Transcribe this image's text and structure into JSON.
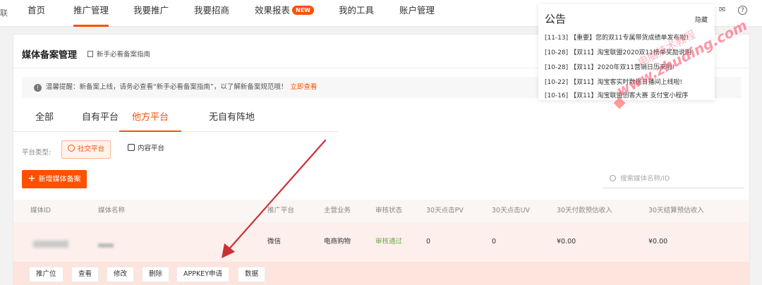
{
  "nav": {
    "logo_stub": "联",
    "items": [
      {
        "label": "首页"
      },
      {
        "label": "推广管理"
      },
      {
        "label": "我要推广"
      },
      {
        "label": "我要招商"
      },
      {
        "label": "效果报表"
      },
      {
        "label": "我的工具"
      },
      {
        "label": "账户管理"
      }
    ],
    "new_badge": "NEW",
    "mail_icon": "mail-icon",
    "help_icon": "help-icon"
  },
  "page": {
    "title": "媒体备案管理",
    "guide_link": "新手必看备案指南"
  },
  "tips": {
    "text": "温馨提醒：新备案上线，请务必查看“新手必看备案指南”，以了解新备案规范哦！",
    "link": "立即查看"
  },
  "tabs": [
    {
      "label": "全部"
    },
    {
      "label": "自有平台"
    },
    {
      "label": "他方平台"
    },
    {
      "label": "无自有阵地"
    }
  ],
  "platform_type": {
    "label": "平台类型:",
    "options": [
      {
        "label": "社交平台"
      },
      {
        "label": "内容平台"
      }
    ]
  },
  "add_button": "新增媒体备案",
  "search_placeholder": "搜索媒体名称/ID",
  "table": {
    "headers": [
      "媒体ID",
      "媒体名称",
      "推广平台",
      "主营业务",
      "审核状态",
      "30天点击PV",
      "30天点击UV",
      "30天付款预估收入",
      "30天结算预估收入"
    ],
    "row": {
      "platform": "微信",
      "business": "电商购物",
      "status": "审核通过",
      "pv": "0",
      "uv": "0",
      "pay_income": "¥0.00",
      "settle_income": "¥0.00"
    },
    "actions": [
      "推广位",
      "查看",
      "修改",
      "删除",
      "APPKEY申请",
      "数据"
    ]
  },
  "notice": {
    "title": "公告",
    "hide": "隐藏",
    "items": [
      {
        "date": "[11-13]",
        "text": "【重要】您的双11专属带货成绩单发布啦!"
      },
      {
        "date": "[10-28]",
        "text": "【双11】淘宝联盟2020双11榜单奖励说明"
      },
      {
        "date": "[10-28]",
        "text": "【双11】2020年双11营销日历来啦!"
      },
      {
        "date": "[10-22]",
        "text": "【双11】淘宝客实时数据日播间上线啦!"
      },
      {
        "date": "[10-16]",
        "text": "【双11】淘宝联盟创客大赛 支付宝小程序"
      }
    ]
  },
  "watermark": {
    "url": "www.zhuding.com",
    "cn": "电脑技术教程"
  },
  "colors": {
    "accent": "#ff5000",
    "approved": "#6ea84a",
    "annotation_arrow": "#cc2f35"
  }
}
